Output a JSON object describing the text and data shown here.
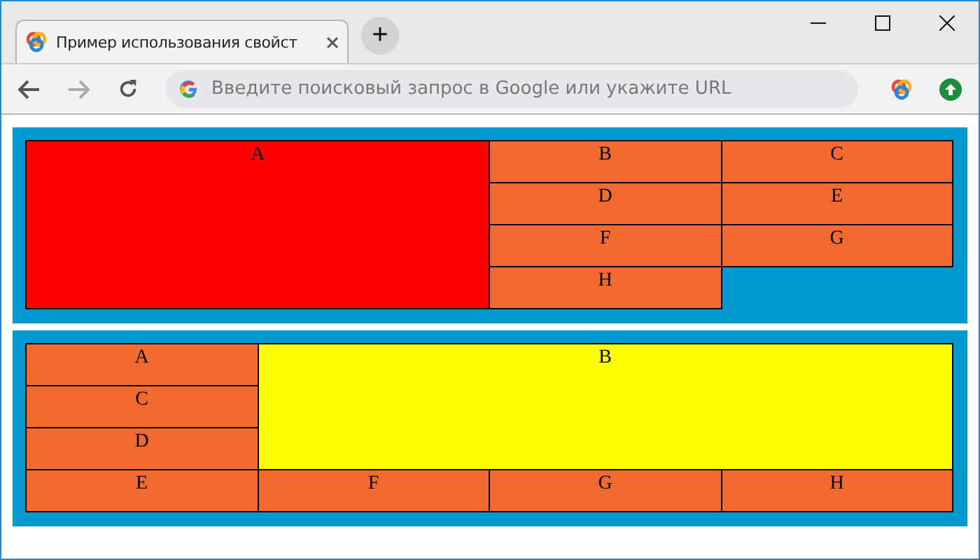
{
  "window": {
    "tab_title": "Пример использования свойст",
    "new_tab": "+",
    "address_placeholder": "Введите поисковый запрос в Google или укажите URL"
  },
  "grids": [
    {
      "kind": "wide-left",
      "items": [
        {
          "label": "A",
          "color": "#ff0000",
          "featured": true
        },
        {
          "label": "B",
          "color": "#f26a2e",
          "featured": false
        },
        {
          "label": "C",
          "color": "#f26a2e",
          "featured": false
        },
        {
          "label": "D",
          "color": "#f26a2e",
          "featured": false
        },
        {
          "label": "E",
          "color": "#f26a2e",
          "featured": false
        },
        {
          "label": "F",
          "color": "#f26a2e",
          "featured": false
        },
        {
          "label": "G",
          "color": "#f26a2e",
          "featured": false
        },
        {
          "label": "H",
          "color": "#f26a2e",
          "featured": false
        }
      ]
    },
    {
      "kind": "wide-right",
      "items": [
        {
          "label": "A",
          "color": "#f26a2e",
          "featured": false
        },
        {
          "label": "B",
          "color": "#ffff00",
          "featured": true
        },
        {
          "label": "C",
          "color": "#f26a2e",
          "featured": false
        },
        {
          "label": "D",
          "color": "#f26a2e",
          "featured": false
        },
        {
          "label": "E",
          "color": "#f26a2e",
          "featured": false
        },
        {
          "label": "F",
          "color": "#f26a2e",
          "featured": false
        },
        {
          "label": "G",
          "color": "#f26a2e",
          "featured": false
        },
        {
          "label": "H",
          "color": "#f26a2e",
          "featured": false
        }
      ]
    }
  ]
}
